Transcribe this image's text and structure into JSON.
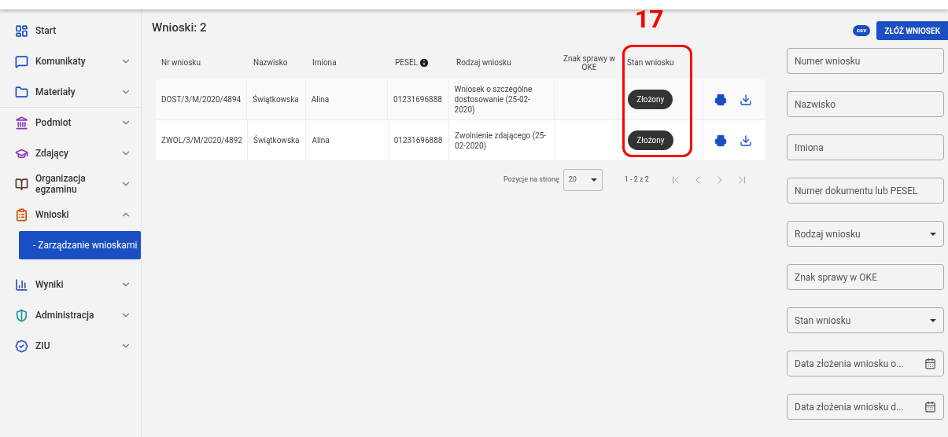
{
  "sidebar": {
    "items": [
      {
        "label": "Start",
        "expandable": false,
        "expanded": false,
        "divider_after": false
      },
      {
        "label": "Komunikaty",
        "expandable": true,
        "expanded": false,
        "divider_after": false
      },
      {
        "label": "Materiały",
        "expandable": true,
        "expanded": false,
        "divider_after": true
      },
      {
        "label": "Podmiot",
        "expandable": true,
        "expanded": false,
        "divider_after": false
      },
      {
        "label": "Zdający",
        "expandable": true,
        "expanded": false,
        "divider_after": false
      },
      {
        "label": "Organizacja egzaminu",
        "expandable": true,
        "expanded": false,
        "divider_after": false
      },
      {
        "label": "Wnioski",
        "expandable": true,
        "expanded": true,
        "divider_after": false,
        "children": [
          {
            "label": "- Zarządzanie wnioskami",
            "selected": true
          }
        ]
      },
      {
        "label": "Wyniki",
        "expandable": true,
        "expanded": false,
        "divider_after": false
      },
      {
        "label": "Administracja",
        "expandable": true,
        "expanded": false,
        "divider_after": false
      },
      {
        "label": "ZIU",
        "expandable": true,
        "expanded": false,
        "divider_after": false
      }
    ]
  },
  "heading": "Wnioski: 2",
  "annotation": {
    "number": "17"
  },
  "toolbar": {
    "csv_label": "csv",
    "submit_button": "ZŁÓŻ WNIOSEK"
  },
  "table": {
    "columns": [
      {
        "label": "Nr wniosku",
        "info": false
      },
      {
        "label": "Nazwisko",
        "info": false
      },
      {
        "label": "Imiona",
        "info": false
      },
      {
        "label": "PESEL",
        "info": true
      },
      {
        "label": "Rodzaj wniosku",
        "info": false
      },
      {
        "label": "Znak sprawy w OKE",
        "info": false
      },
      {
        "label": "Stan wniosku",
        "info": false
      }
    ],
    "rows": [
      {
        "cells": [
          "DOST/3/M/2020/4894",
          "Świątkowska",
          "Alina",
          "01231696888",
          "Wniosek o szczególne dostosowanie (25-02-2020)",
          ""
        ],
        "status": "Złożony"
      },
      {
        "cells": [
          "ZWOL/3/M/2020/4892",
          "Świątkowska",
          "Alina",
          "01231696888",
          "Zwolnienie zdającego (25-02-2020)",
          ""
        ],
        "status": "Złożony"
      }
    ]
  },
  "pagination": {
    "per_page_label": "Pozycje na stronę",
    "per_page": "20",
    "range": "1 - 2 z 2"
  },
  "filters": [
    {
      "kind": "text",
      "placeholder": "Numer wniosku"
    },
    {
      "kind": "text",
      "placeholder": "Nazwisko"
    },
    {
      "kind": "text",
      "placeholder": "Imiona"
    },
    {
      "kind": "text",
      "placeholder": "Numer dokumentu lub PESEL"
    },
    {
      "kind": "select",
      "placeholder": "Rodzaj wniosku"
    },
    {
      "kind": "text",
      "placeholder": "Znak sprawy w OKE"
    },
    {
      "kind": "select",
      "placeholder": "Stan wniosku"
    },
    {
      "kind": "date",
      "placeholder": "Data złożenia wniosku o..."
    },
    {
      "kind": "date",
      "placeholder": "Data złożenia wniosku d..."
    }
  ]
}
